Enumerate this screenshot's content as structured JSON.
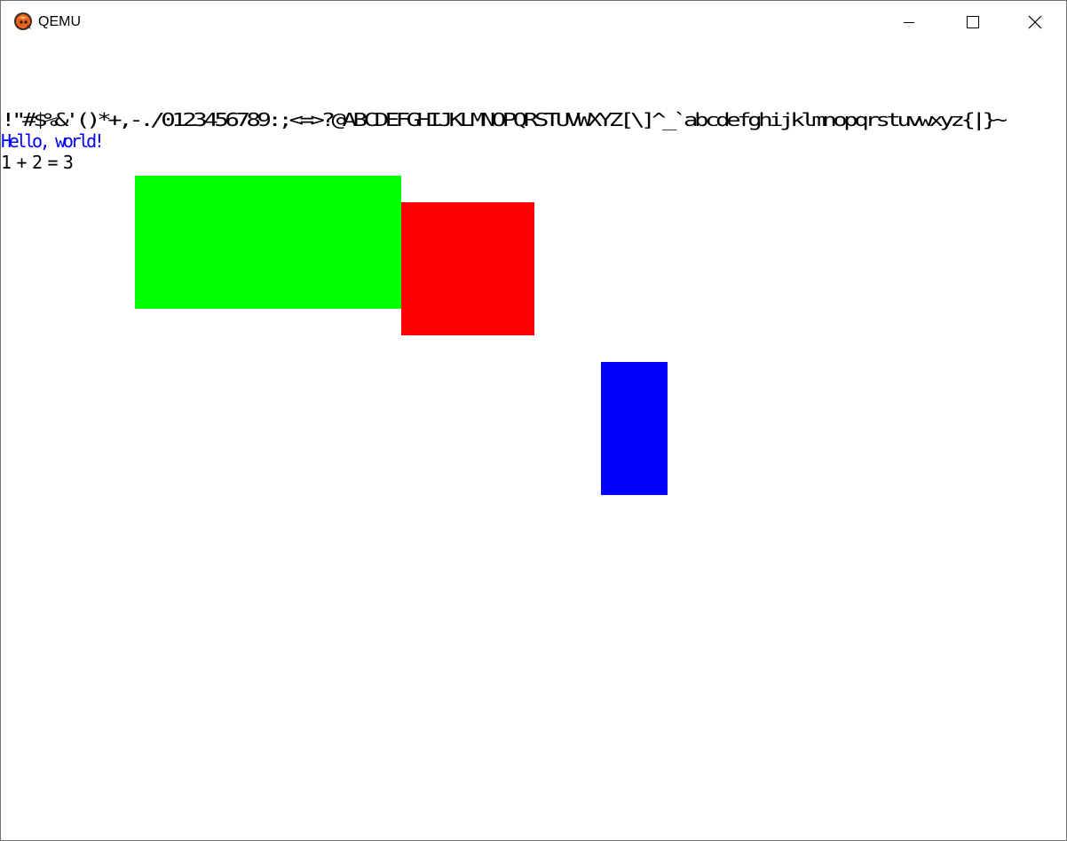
{
  "window": {
    "title": "QEMU",
    "icon": "qemu-logo-icon",
    "controls": {
      "minimize": "minimize-icon",
      "maximize": "maximize-icon",
      "close": "close-icon"
    }
  },
  "console": {
    "charset_line": "!\"#$%&'()*+,-./0123456789:;<=>?@ABCDEFGHIJKLMNOPQRSTUVWXYZ[\\]^_`abcdefghijklmnopqrstuvwxyz{|}~",
    "hello_line": "Hello, world!",
    "math_line": "1 + 2 = 3",
    "colors": {
      "default": "#000000",
      "hello": "#0000ff"
    }
  },
  "shapes": [
    {
      "name": "green-rectangle",
      "color": "#00ff00"
    },
    {
      "name": "red-rectangle",
      "color": "#ff0000"
    },
    {
      "name": "blue-rectangle",
      "color": "#0000ff"
    }
  ]
}
